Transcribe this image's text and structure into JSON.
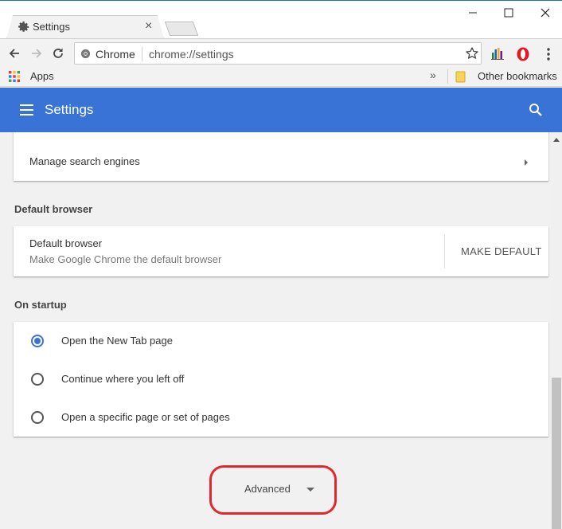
{
  "window": {
    "tab_title": "Settings",
    "tab_close": "×",
    "controls": {
      "minimize": "minimize",
      "maximize": "maximize",
      "close": "close"
    }
  },
  "toolbar": {
    "site_chip": "Chrome",
    "url": "chrome://settings"
  },
  "bookmarks": {
    "apps_label": "Apps",
    "overflow": "»",
    "other_label": "Other bookmarks"
  },
  "header": {
    "title": "Settings",
    "bg_color": "#3a73d6"
  },
  "search_engine": {
    "manage_label": "Manage search engines"
  },
  "default_browser": {
    "section_label": "Default browser",
    "title": "Default browser",
    "subtitle": "Make Google Chrome the default browser",
    "button_label": "MAKE DEFAULT"
  },
  "on_startup": {
    "section_label": "On startup",
    "options": [
      {
        "label": "Open the New Tab page",
        "selected": true
      },
      {
        "label": "Continue where you left off",
        "selected": false
      },
      {
        "label": "Open a specific page or set of pages",
        "selected": false
      }
    ]
  },
  "advanced": {
    "label": "Advanced",
    "highlight_color": "#e0282d"
  },
  "icons": {
    "tab": "gear-icon",
    "back": "arrow-left-icon",
    "forward": "arrow-right-icon",
    "reload": "reload-icon",
    "site": "chrome-site-icon",
    "bookmark": "star-icon",
    "extension_1": "chart-extension-icon",
    "extension_2": "opera-extension-icon",
    "menu": "more-vert-icon",
    "apps": "apps-grid-icon",
    "folder": "folder-icon",
    "hamburger": "menu-icon",
    "search": "search-icon",
    "submenu": "chevron-right-icon",
    "expand": "caret-down-icon"
  }
}
